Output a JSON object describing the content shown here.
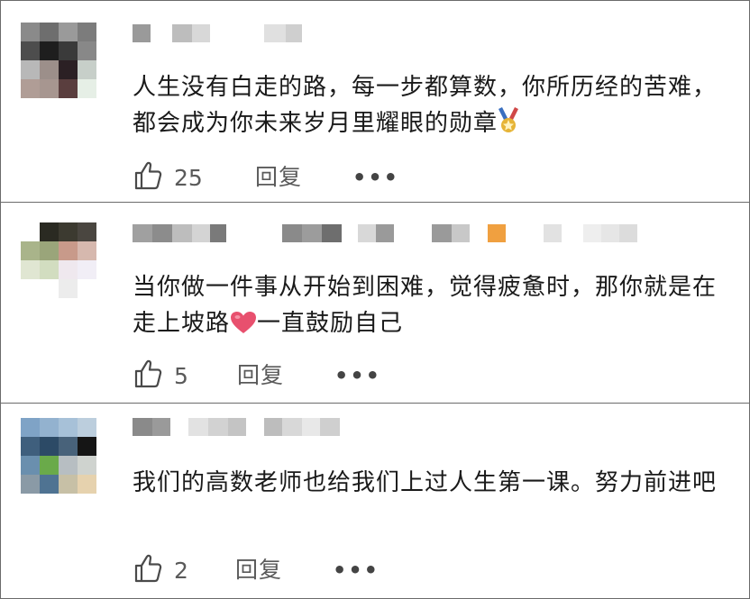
{
  "comments": [
    {
      "text": "人生没有白走的路，每一步都算数，你所历经的苦难，都会成为你未来岁月里耀眼的勋章",
      "emoji": "medal-icon",
      "likes": "25",
      "reply_label": "回复",
      "more_label": "•••"
    },
    {
      "text_before": "当你做一件事从开始到困难，觉得疲惫时，那你就是在走上坡路",
      "emoji": "heart-icon",
      "text_after": "一直鼓励自己",
      "likes": "5",
      "reply_label": "回复",
      "more_label": "•••"
    },
    {
      "text": "我们的高数老师也给我们上过人生第一课。努力前进吧",
      "likes": "2",
      "reply_label": "回复",
      "more_label": "•••"
    }
  ],
  "colors": {
    "border": "#6b6b6b",
    "text": "#1a1a1a",
    "muted": "#5a5a5a",
    "badge_orange": "#f0a040",
    "heart": "#e8506e"
  }
}
